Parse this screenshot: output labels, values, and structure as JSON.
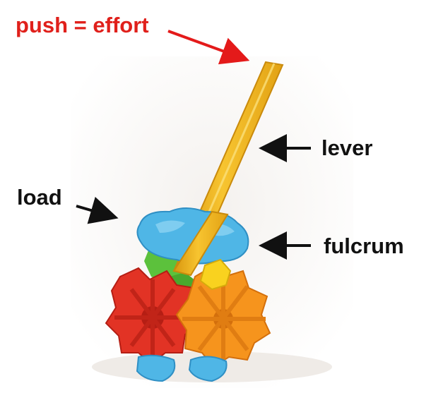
{
  "labels": {
    "effort": "push = effort",
    "lever": "lever",
    "load": "load",
    "fulcrum": "fulcrum"
  },
  "colors": {
    "effort_text": "#e0201b",
    "effort_arrow": "#e41a1a",
    "label_text": "#111111",
    "arrow": "#111111",
    "pencil": "#f2b318",
    "pencil_edge": "#c98a0c",
    "blue_piece": "#4fb6e6",
    "red_piece": "#e23325",
    "orange_piece": "#f6941d",
    "yellow_piece": "#f9d21f",
    "green_piece": "#5cc13c",
    "shadow": "#e6e1dc"
  },
  "icons": [
    "pencil-lever",
    "construction-toy-fulcrum"
  ]
}
